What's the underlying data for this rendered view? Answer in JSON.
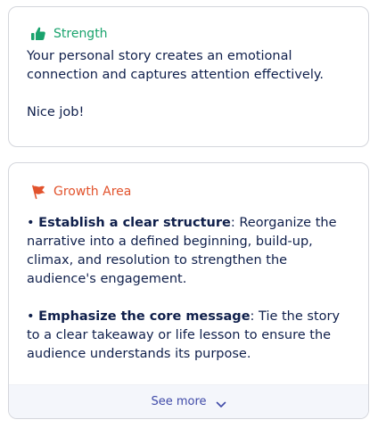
{
  "strength": {
    "title": "Strength",
    "icon": "thumbs-up-icon",
    "accent": "#1aa36d",
    "text": "Your personal story creates an emotional connection and captures attention effectively.",
    "extra": "Nice job!"
  },
  "growth": {
    "title": "Growth Area",
    "icon": "flag-icon",
    "accent": "#e2532d",
    "bullets": [
      {
        "bullet": "•",
        "heading": "Establish a clear structure",
        "sep": ":",
        "text": " Reorganize the narrative into a defined beginning, build-up, climax, and resolution to strengthen the audience's engagement."
      },
      {
        "bullet": "•",
        "heading": "Emphasize the core message",
        "sep": ":",
        "text": " Tie the story to a clear takeaway or life lesson to ensure the audience understands its purpose."
      }
    ],
    "see_more": "See more"
  }
}
